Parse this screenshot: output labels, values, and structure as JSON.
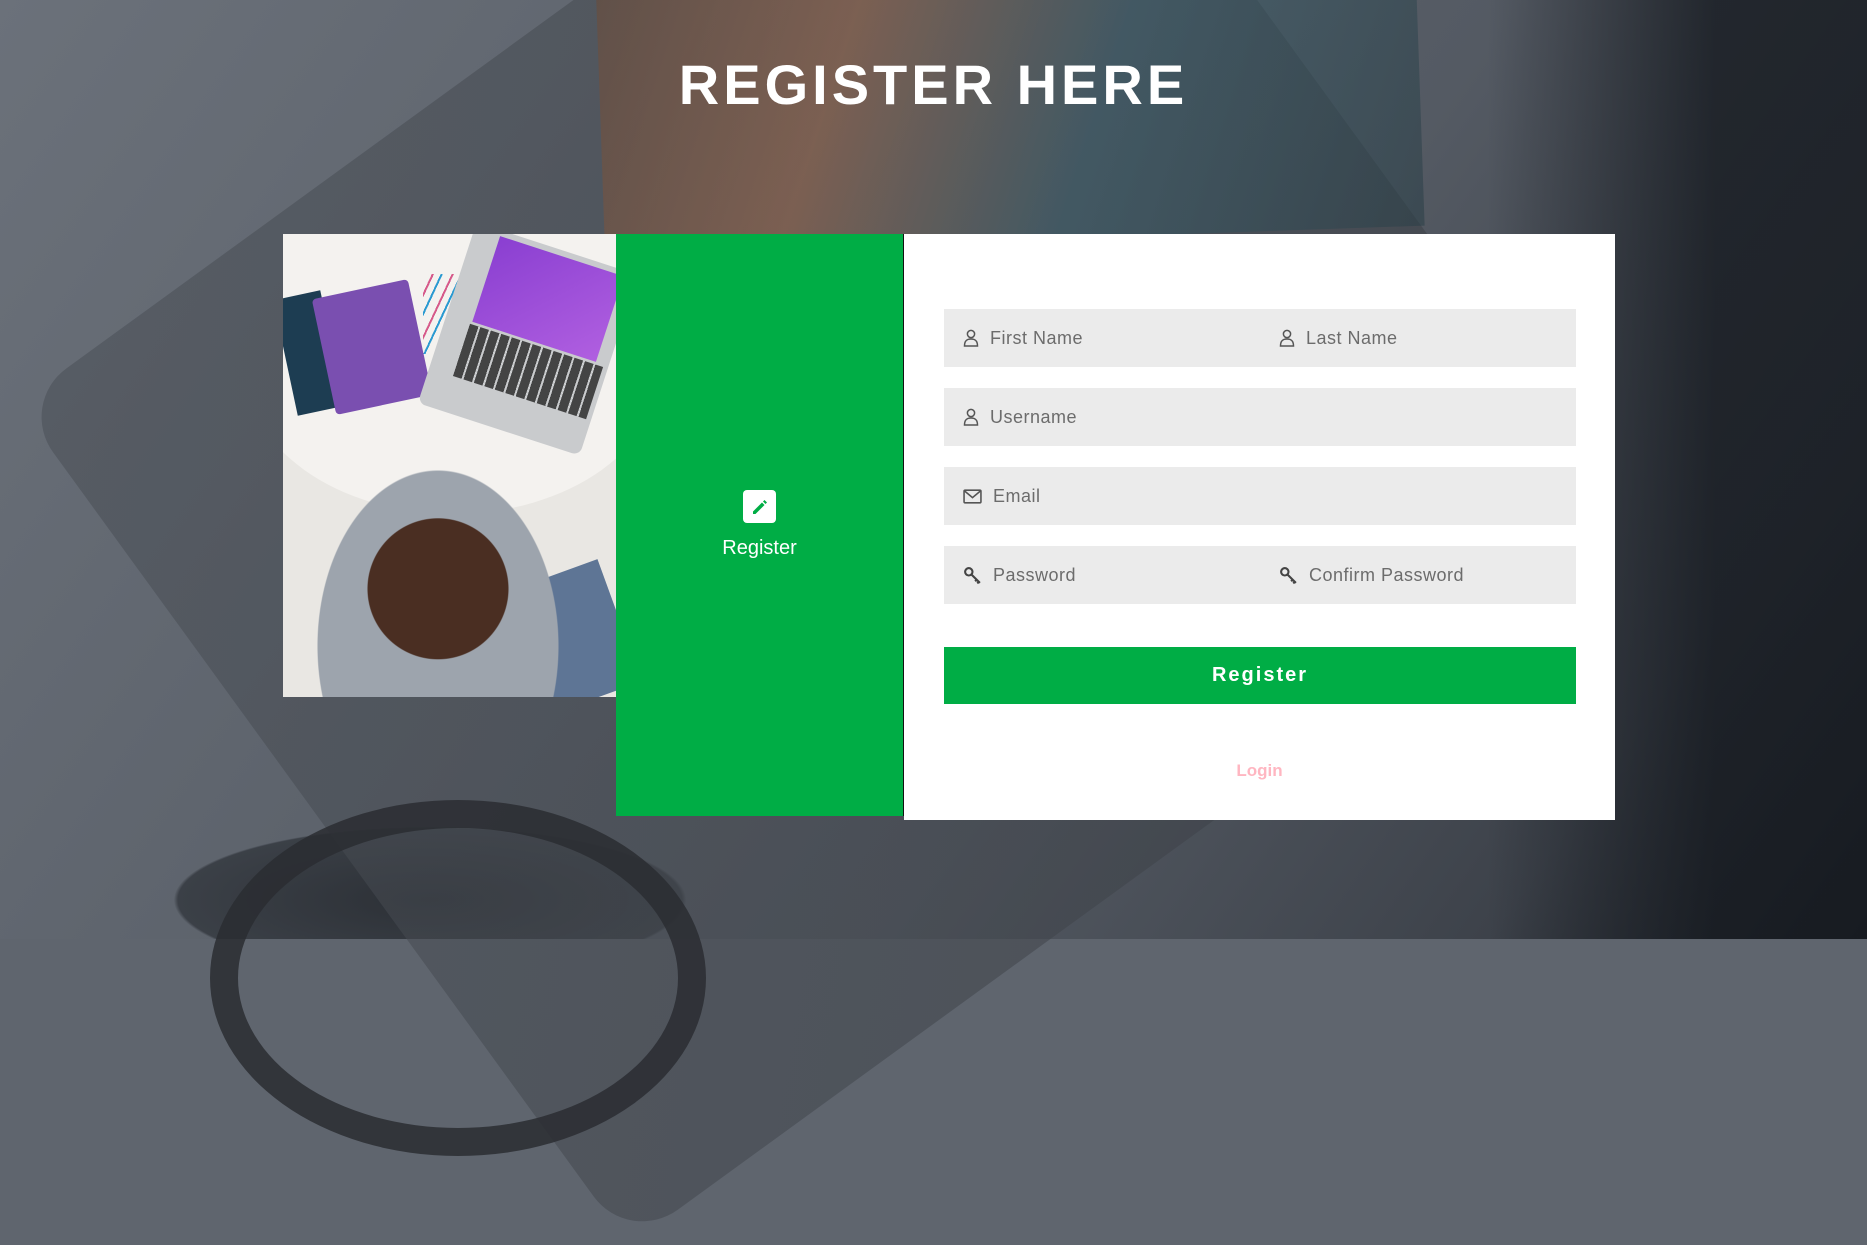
{
  "page": {
    "title": "REGISTER HERE"
  },
  "side_panel": {
    "label": "Register",
    "icon": "pencil-edit-icon",
    "color": "#00ad45"
  },
  "form": {
    "first_name": {
      "placeholder": "First Name",
      "value": ""
    },
    "last_name": {
      "placeholder": "Last Name",
      "value": ""
    },
    "username": {
      "placeholder": "Username",
      "value": ""
    },
    "email": {
      "placeholder": "Email",
      "value": ""
    },
    "password": {
      "placeholder": "Password",
      "value": ""
    },
    "confirm_password": {
      "placeholder": "Confirm Password",
      "value": ""
    },
    "submit_label": "Register",
    "login_link": "Login",
    "accent_color": "#00ad45",
    "link_color": "#ffb6c1"
  }
}
